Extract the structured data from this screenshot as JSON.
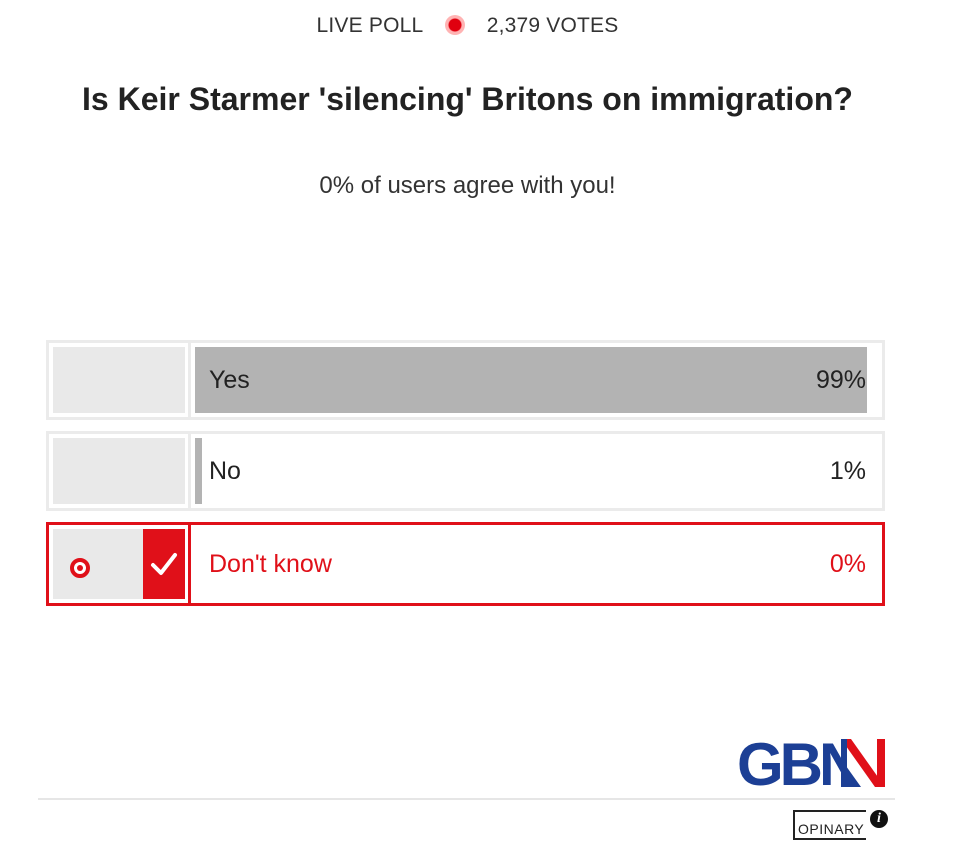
{
  "header": {
    "live_label": "LIVE POLL",
    "votes_label": "2,379 VOTES"
  },
  "question": "Is Keir Starmer 'silencing' Britons on immigration?",
  "agree_text": "0% of users agree with you!",
  "options": [
    {
      "label": "Yes",
      "percent_text": "99%",
      "percent": 99,
      "selected": false
    },
    {
      "label": "No",
      "percent_text": "1%",
      "percent": 1,
      "selected": false
    },
    {
      "label": "Don't know",
      "percent_text": "0%",
      "percent": 0,
      "selected": true
    }
  ],
  "branding": {
    "logo_text": "GBN",
    "opinary_label": "OPINARY"
  },
  "colors": {
    "accent": "#e01019",
    "bar": "#b3b3b3",
    "logo_blue": "#1c3f95"
  },
  "icons": {
    "live_indicator": "live-dot-icon",
    "selected_marker": "target-icon",
    "check": "checkmark-icon",
    "info": "info-icon"
  }
}
